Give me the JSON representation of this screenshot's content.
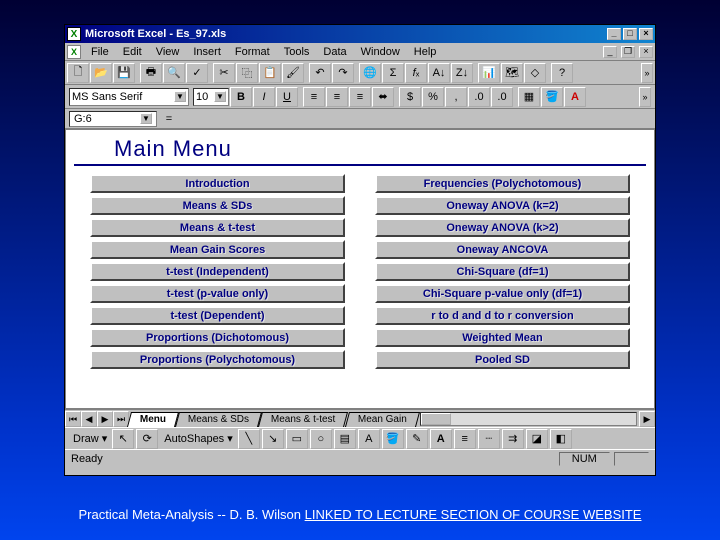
{
  "window": {
    "title": "Microsoft Excel - Es_97.xls"
  },
  "menu": {
    "items": [
      "File",
      "Edit",
      "View",
      "Insert",
      "Format",
      "Tools",
      "Data",
      "Window",
      "Help"
    ]
  },
  "format": {
    "font": "MS Sans Serif",
    "size": "10"
  },
  "formula": {
    "cell": "G:6",
    "eq": "="
  },
  "main": {
    "title": "Main Menu",
    "left": [
      "Introduction",
      "Means & SDs",
      "Means & t-test",
      "Mean Gain Scores",
      "t-test (Independent)",
      "t-test (p-value only)",
      "t-test (Dependent)",
      "Proportions (Dichotomous)",
      "Proportions (Polychotomous)"
    ],
    "right": [
      "Frequencies (Polychotomous)",
      "Oneway ANOVA (k=2)",
      "Oneway ANOVA (k>2)",
      "Oneway ANCOVA",
      "Chi-Square (df=1)",
      "Chi-Square p-value only (df=1)",
      "r to d and d to r conversion",
      "Weighted Mean",
      "Pooled SD"
    ]
  },
  "tabs": {
    "items": [
      "Menu",
      "Means & SDs",
      "Means & t-test",
      "Mean Gain"
    ]
  },
  "draw": {
    "label": "Draw",
    "autoshapes": "AutoShapes"
  },
  "status": {
    "ready": "Ready",
    "num": "NUM"
  },
  "footer": {
    "a": "Practical Meta-Analysis -- D. B. Wilson",
    "b": "LINKED TO LECTURE SECTION OF COURSE WEBSITE"
  }
}
